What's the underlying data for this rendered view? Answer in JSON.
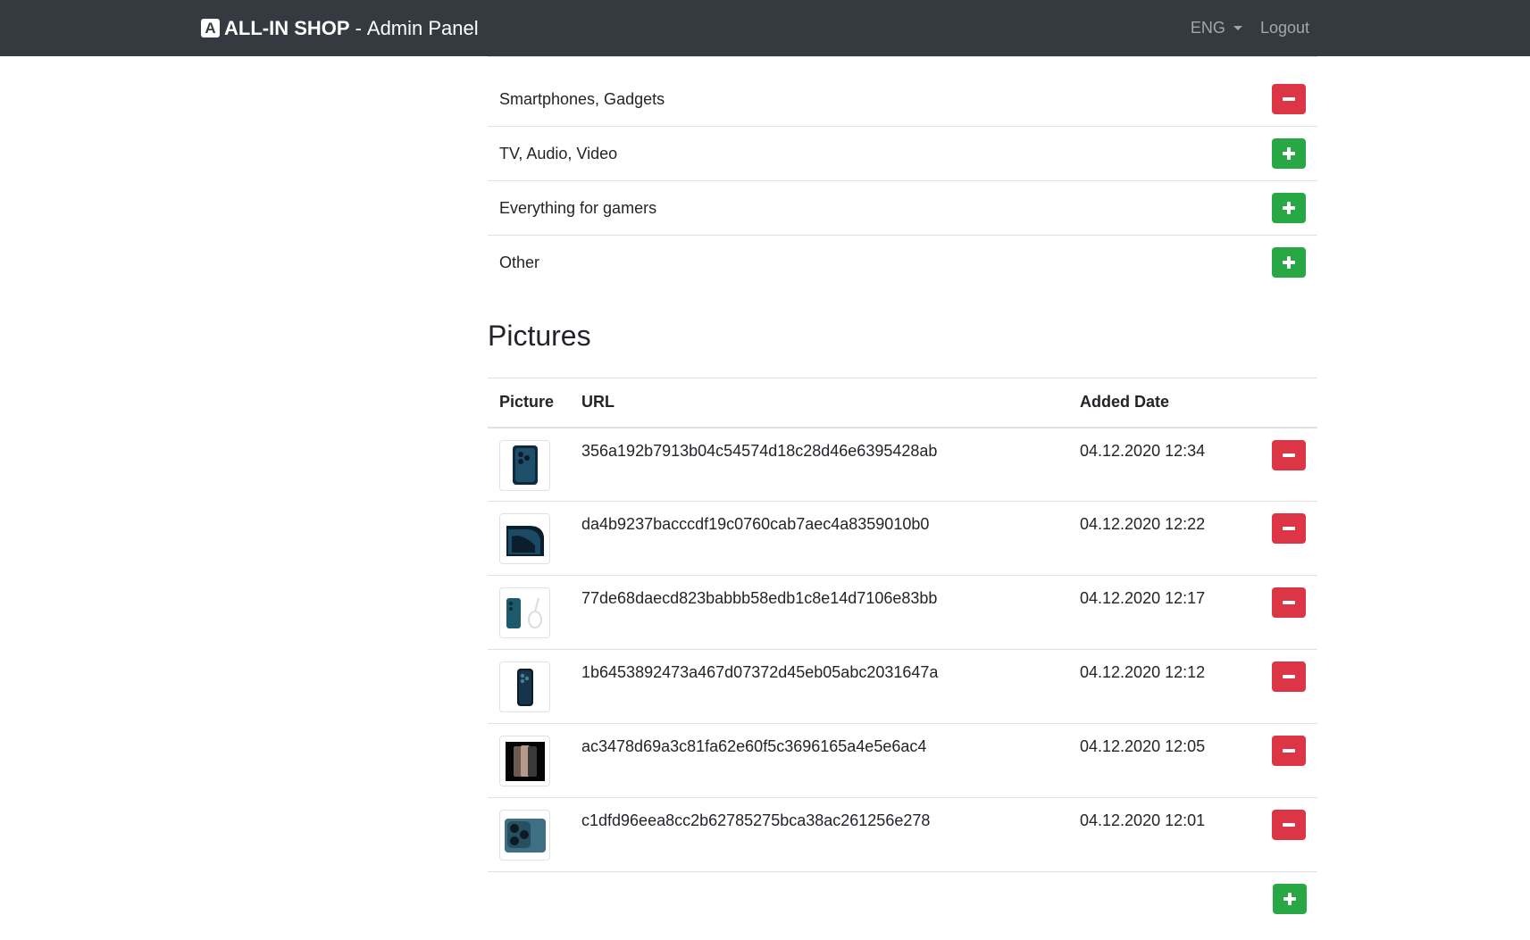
{
  "navbar": {
    "brand_logo": "A",
    "brand_name": "ALL-IN SHOP",
    "brand_separator": "-",
    "brand_suffix": "Admin Panel",
    "language": "ENG",
    "logout": "Logout",
    "bg_color": "#343a40"
  },
  "categories": [
    {
      "name": "Smartphones, Gadgets",
      "action": "remove"
    },
    {
      "name": "TV, Audio, Video",
      "action": "add"
    },
    {
      "name": "Everything for gamers",
      "action": "add"
    },
    {
      "name": "Other",
      "action": "add"
    }
  ],
  "pictures": {
    "title": "Pictures",
    "headers": {
      "picture": "Picture",
      "url": "URL",
      "added_date": "Added Date"
    },
    "rows": [
      {
        "url": "356a192b7913b04c54574d18c28d46e6395428ab",
        "date": "04.12.2020 12:34",
        "thumb": "phone-back-icon"
      },
      {
        "url": "da4b9237bacccdf19c0760cab7aec4a8359010b0",
        "date": "04.12.2020 12:22",
        "thumb": "phone-closeup-icon"
      },
      {
        "url": "77de68daecd823babbb58edb1c8e14d7106e83bb",
        "date": "04.12.2020 12:17",
        "thumb": "phone-with-cable-icon"
      },
      {
        "url": "1b6453892473a467d07372d45eb05abc2031647a",
        "date": "04.12.2020 12:12",
        "thumb": "phone-back-blue-icon"
      },
      {
        "url": "ac3478d69a3c81fa62e60f5c3696165a4e5e6ac4",
        "date": "04.12.2020 12:05",
        "thumb": "phones-lineup-icon"
      },
      {
        "url": "c1dfd96eea8cc2b62785275bca38ac261256e278",
        "date": "04.12.2020 12:01",
        "thumb": "phone-camera-icon"
      }
    ]
  },
  "colors": {
    "danger": "#dc3545",
    "success": "#28a745",
    "border": "#dee2e6"
  }
}
